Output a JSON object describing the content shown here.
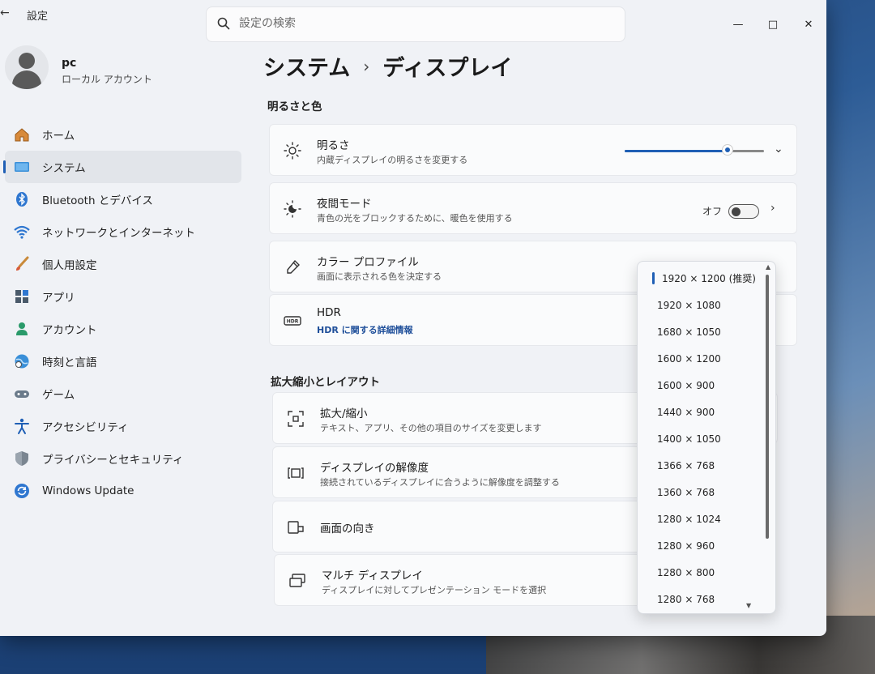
{
  "window": {
    "app_title": "設定",
    "back_icon": "arrow-left-icon",
    "controls": {
      "minimize": "—",
      "maximize": "□",
      "close": "✕"
    }
  },
  "search": {
    "placeholder": "設定の検索",
    "icon": "search-icon"
  },
  "profile": {
    "name": "pc",
    "account_type": "ローカル アカウント"
  },
  "sidebar": {
    "items": [
      {
        "label": "ホーム",
        "icon": "home-icon"
      },
      {
        "label": "システム",
        "icon": "system-monitor-icon",
        "active": true
      },
      {
        "label": "Bluetooth とデバイス",
        "icon": "bluetooth-icon"
      },
      {
        "label": "ネットワークとインターネット",
        "icon": "wifi-icon"
      },
      {
        "label": "個人用設定",
        "icon": "brush-icon"
      },
      {
        "label": "アプリ",
        "icon": "apps-icon"
      },
      {
        "label": "アカウント",
        "icon": "account-icon"
      },
      {
        "label": "時刻と言語",
        "icon": "globe-clock-icon"
      },
      {
        "label": "ゲーム",
        "icon": "gamepad-icon"
      },
      {
        "label": "アクセシビリティ",
        "icon": "accessibility-icon"
      },
      {
        "label": "プライバシーとセキュリティ",
        "icon": "shield-icon"
      },
      {
        "label": "Windows Update",
        "icon": "update-icon"
      }
    ]
  },
  "breadcrumb": {
    "parent": "システム",
    "separator": "›",
    "current": "ディスプレイ"
  },
  "sections": {
    "brightness_color": "明るさと色",
    "scale_layout": "拡大縮小とレイアウト"
  },
  "cards": {
    "brightness": {
      "title": "明るさ",
      "subtitle": "内蔵ディスプレイの明るさを変更する",
      "value": 0.74
    },
    "night_light": {
      "title": "夜間モード",
      "subtitle": "青色の光をブロックするために、暖色を使用する",
      "state": "オフ"
    },
    "color_profile": {
      "title": "カラー プロファイル",
      "subtitle": "画面に表示される色を決定する"
    },
    "hdr": {
      "title": "HDR",
      "link": "HDR に関する詳細情報"
    },
    "scale": {
      "title": "拡大/縮小",
      "subtitle": "テキスト、アプリ、その他の項目のサイズを変更します"
    },
    "resolution": {
      "title": "ディスプレイの解像度",
      "subtitle": "接続されているディスプレイに合うように解像度を調整する"
    },
    "orientation": {
      "title": "画面の向き"
    },
    "multi_display": {
      "title": "マルチ ディスプレイ",
      "subtitle": "ディスプレイに対してプレゼンテーション モードを選択"
    }
  },
  "resolution_dropdown": {
    "selected_index": 0,
    "options": [
      "1920 × 1200 (推奨)",
      "1920 × 1080",
      "1680 × 1050",
      "1600 × 1200",
      "1600 × 900",
      "1440 × 900",
      "1400 × 1050",
      "1366 × 768",
      "1360 × 768",
      "1280 × 1024",
      "1280 × 960",
      "1280 × 800",
      "1280 × 768"
    ]
  },
  "colors": {
    "accent": "#1f5fb5",
    "window_bg": "#f0f2f6",
    "card_bg": "#fafbfc"
  }
}
